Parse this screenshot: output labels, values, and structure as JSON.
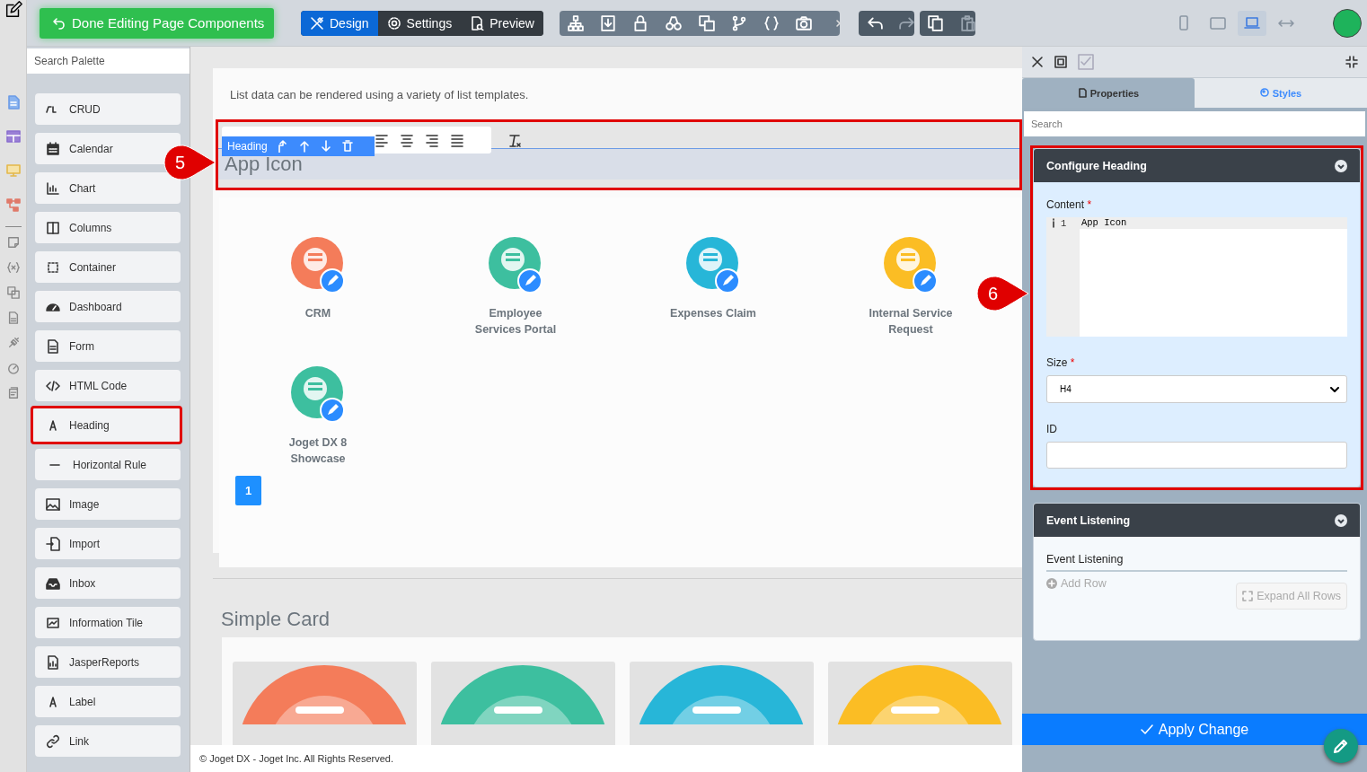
{
  "toolbar": {
    "done_button": "Done Editing Page Components",
    "modes": [
      {
        "label": "Design",
        "selected": true
      },
      {
        "label": "Settings",
        "selected": false
      },
      {
        "label": "Preview",
        "selected": false
      }
    ],
    "devices": [
      {
        "kind": "phone",
        "selected": false
      },
      {
        "kind": "tablet",
        "selected": false
      },
      {
        "kind": "laptop",
        "selected": true
      },
      {
        "kind": "full-width",
        "selected": false
      }
    ]
  },
  "palette": {
    "search_placeholder": "Search Palette",
    "items": [
      {
        "label": "CRUD",
        "highlighted": false
      },
      {
        "label": "Calendar",
        "highlighted": false
      },
      {
        "label": "Chart",
        "highlighted": false
      },
      {
        "label": "Columns",
        "highlighted": false
      },
      {
        "label": "Container",
        "highlighted": false
      },
      {
        "label": "Dashboard",
        "highlighted": false
      },
      {
        "label": "Form",
        "highlighted": false
      },
      {
        "label": "HTML Code",
        "highlighted": false
      },
      {
        "label": "Heading",
        "highlighted": true
      },
      {
        "label": "Horizontal Rule",
        "highlighted": false
      },
      {
        "label": "Image",
        "highlighted": false
      },
      {
        "label": "Import",
        "highlighted": false
      },
      {
        "label": "Inbox",
        "highlighted": false
      },
      {
        "label": "Information Tile",
        "highlighted": false
      },
      {
        "label": "JasperReports",
        "highlighted": false
      },
      {
        "label": "Label",
        "highlighted": false
      },
      {
        "label": "Link",
        "highlighted": false
      }
    ]
  },
  "canvas": {
    "intro": "List data can be rendered using a variety of list templates.",
    "selected_element": {
      "badge": "Heading",
      "text": "App Icon"
    },
    "apps": [
      {
        "name": "CRM",
        "color": "#f47c5a"
      },
      {
        "name": "Employee Services Portal",
        "color": "#3dbf9f"
      },
      {
        "name": "Expenses Claim",
        "color": "#27b6d8"
      },
      {
        "name": "Internal Service Request",
        "color": "#fbbd24"
      },
      {
        "name": "Joget DX 8 Showcase",
        "color": "#3dbf9f"
      }
    ],
    "pages": [
      {
        "label": "1",
        "selected": true
      }
    ],
    "section_heading": "Simple Card",
    "cards": [
      {
        "color": "#f47c5a"
      },
      {
        "color": "#3dbf9f"
      },
      {
        "color": "#27b6d8"
      },
      {
        "color": "#fbbd24"
      }
    ],
    "footer": "© Joget DX - Joget Inc. All Rights Reserved."
  },
  "properties": {
    "tabs": [
      {
        "label": "Properties",
        "selected": true
      },
      {
        "label": "Styles",
        "selected": false
      }
    ],
    "search_placeholder": "Search",
    "sections": [
      {
        "title": "Configure Heading",
        "highlighted": true,
        "fields": [
          {
            "kind": "code",
            "label": "Content",
            "required_mark": "*",
            "lines": [
              {
                "number": "1",
                "text": "App Icon"
              }
            ]
          },
          {
            "kind": "select",
            "label": "Size",
            "required_mark": "*",
            "value": "H4"
          },
          {
            "kind": "text",
            "label": "ID"
          }
        ]
      },
      {
        "title": "Event Listening",
        "highlighted": false,
        "fields": [
          {
            "kind": "grid",
            "label": "Event Listening",
            "add_label": "Add Row",
            "expand_label": "Expand All Rows"
          }
        ]
      }
    ],
    "apply_button": "Apply Change"
  },
  "annotations": [
    {
      "number": "5"
    },
    {
      "number": "6"
    }
  ]
}
